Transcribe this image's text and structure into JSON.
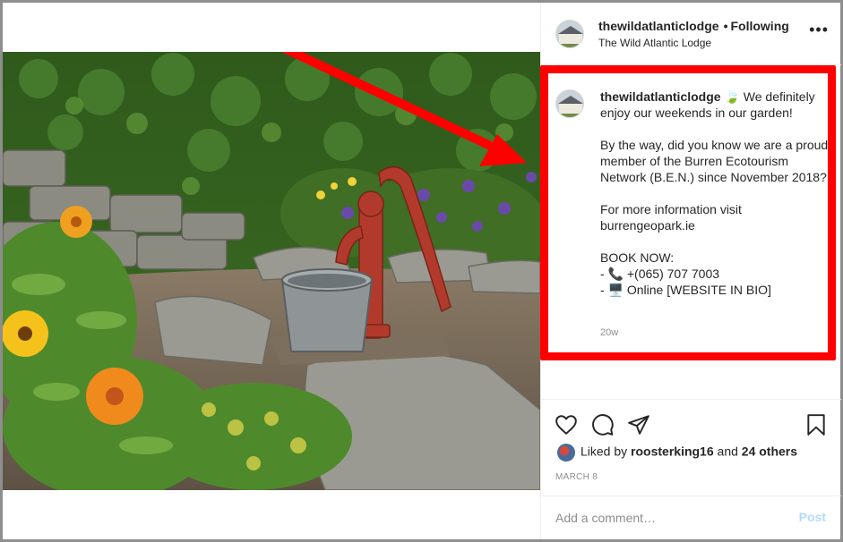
{
  "post": {
    "username": "thewildatlanticlodge",
    "separator": "•",
    "follow_status": "Following",
    "location": "The Wild Atlantic Lodge",
    "more_label": "•••"
  },
  "caption": {
    "username": "thewildatlanticlodge",
    "text": " 🍃 We definitely enjoy our weekends in our garden!\n\nBy the way, did you know we are a proud member of the Burren Ecotourism Network (B.E.N.) since November 2018?\n\nFor more information visit burrengeopark.ie\n\nBOOK NOW:\n- 📞 +(065) 707 7003\n- 🖥️ Online [WEBSITE IN BIO]",
    "time_ago": "20w"
  },
  "likes": {
    "prefix": "Liked by ",
    "user": "roosterking16",
    "middle": " and ",
    "others": "24 others"
  },
  "date": "MARCH 8",
  "comment": {
    "placeholder": "Add a comment…",
    "post_label": "Post"
  },
  "icons": {
    "like": "heart-icon",
    "comment": "speech-bubble-icon",
    "share": "paper-plane-icon",
    "save": "bookmark-icon"
  },
  "colors": {
    "annotation": "#ff0000",
    "post_button": "#b3dbff",
    "secondary_text": "#8e8e8e"
  }
}
